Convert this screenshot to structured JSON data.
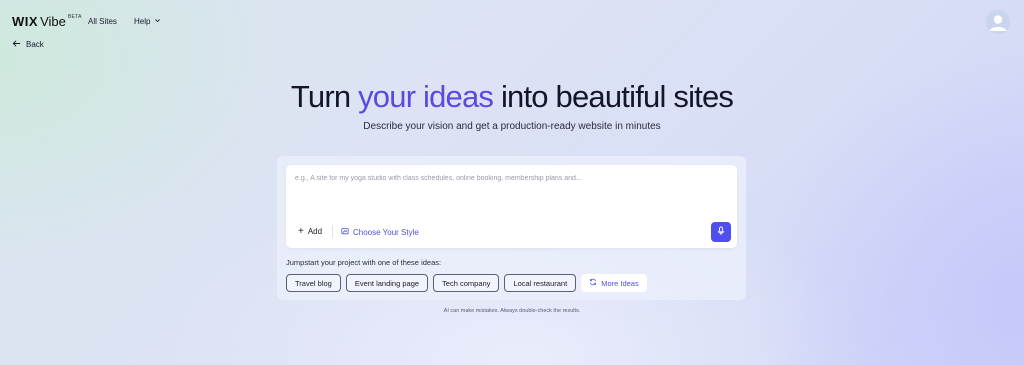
{
  "header": {
    "logo_wix": "WIX",
    "logo_vibe": "Vibe",
    "logo_badge": "BETA",
    "nav_all_sites": "All Sites",
    "nav_help": "Help",
    "back_label": "Back"
  },
  "hero": {
    "title_part1": "Turn ",
    "title_accent": "your ideas",
    "title_part2": " into beautiful sites",
    "subtitle": "Describe your vision and get a production-ready website in minutes"
  },
  "prompt": {
    "placeholder": "e.g., A site for my yoga studio with class schedules, online booking, membership plans and...",
    "value": "",
    "add_label": "Add",
    "style_label": "Choose Your Style"
  },
  "ideas": {
    "label": "Jumpstart your project with one of these ideas:",
    "chips": [
      "Travel blog",
      "Event landing page",
      "Tech company",
      "Local restaurant"
    ],
    "more_label": "More Ideas"
  },
  "disclaimer": "AI can make mistakes. Always double-check the results.",
  "colors": {
    "accent": "#5a4be0",
    "mic_button": "#4f4ff0",
    "link": "#4b52d8"
  },
  "icons": {
    "help_dropdown": "chevron-down-icon",
    "back": "arrow-left-icon",
    "avatar": "user-avatar-icon",
    "add": "plus-icon",
    "style": "style-icon",
    "mic": "microphone-icon",
    "more_ideas": "refresh-icon"
  }
}
